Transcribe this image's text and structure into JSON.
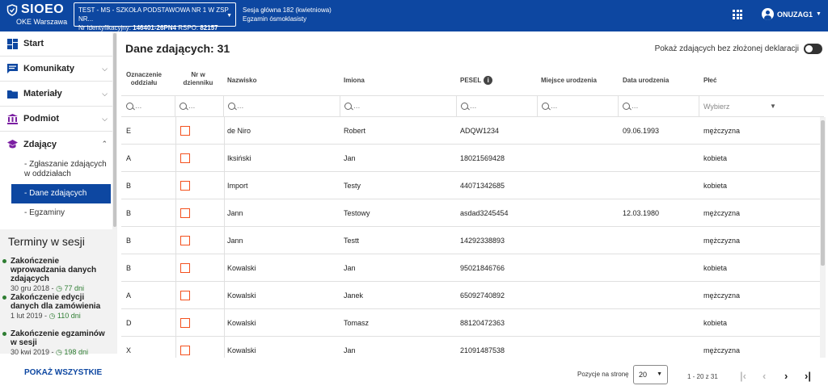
{
  "header": {
    "app_name": "SIOEO",
    "org": "OKE Warszawa",
    "school_line1": "TEST - MS - SZKOŁA PODSTAWOWA NR 1 W ZSP NR...",
    "school_id_label": "Nr identyfikacyjny:",
    "school_id_value": "146401-26PN4",
    "rspo_label": "RSPO:",
    "rspo_value": "82157",
    "session_line1": "Sesja główna 182 (kwietniowa)",
    "session_line2": "Egzamin ósmoklasisty",
    "user_name": "ONUZAG1",
    "icons": [
      "apps-icon",
      "account-icon",
      "caret-down-icon"
    ]
  },
  "sidebar": {
    "items": [
      {
        "label": "Start",
        "icon": "dashboard-icon"
      },
      {
        "label": "Komunikaty",
        "icon": "message-icon"
      },
      {
        "label": "Materiały",
        "icon": "folder-icon"
      },
      {
        "label": "Podmiot",
        "icon": "bank-icon"
      },
      {
        "label": "Zdający",
        "icon": "graduation-cap-icon"
      }
    ],
    "subitems": [
      {
        "label": "- Zgłaszanie zdających w oddziałach"
      },
      {
        "label": "- Dane zdających"
      },
      {
        "label": "- Egzaminy"
      }
    ],
    "terms_title": "Terminy w sesji",
    "terms": [
      {
        "title": "Zakończenie wprowadzania danych zdających",
        "date": "30 gru 2018 -",
        "days": "77 dni"
      },
      {
        "title": "Zakończenie edycji danych dla zamówienia",
        "date": "1 lut 2019 -",
        "days": "110 dni"
      },
      {
        "title": "Zakończenie egzaminów w sesji",
        "date": "30 kwi 2019 -",
        "days": "198 dni"
      }
    ],
    "show_all": "POKAŻ WSZYSTKIE"
  },
  "main": {
    "title": "Dane zdających: 31",
    "toggle_label": "Pokaż zdających bez złożonej deklaracji",
    "toggle_on": false,
    "columns": [
      "Oznaczenie oddziału",
      "Nr w dzienniku",
      "Nazwisko",
      "Imiona",
      "PESEL",
      "Miejsce urodzenia",
      "Data urodzenia",
      "Płeć"
    ],
    "filter_placeholder": "...",
    "gender_filter_placeholder": "Wybierz",
    "rows": [
      {
        "class": "E",
        "surname": "de Niro",
        "names": "Robert",
        "pesel": "ADQW1234",
        "birthplace": "",
        "birthdate": "09.06.1993",
        "gender": "mężczyzna"
      },
      {
        "class": "A",
        "surname": "Iksiński",
        "names": "Jan",
        "pesel": "18021569428",
        "birthplace": "",
        "birthdate": "",
        "gender": "kobieta"
      },
      {
        "class": "B",
        "surname": "Import",
        "names": "Testy",
        "pesel": "44071342685",
        "birthplace": "",
        "birthdate": "",
        "gender": "kobieta"
      },
      {
        "class": "B",
        "surname": "Jann",
        "names": "Testowy",
        "pesel": "asdad3245454",
        "birthplace": "",
        "birthdate": "12.03.1980",
        "gender": "mężczyzna"
      },
      {
        "class": "B",
        "surname": "Jann",
        "names": "Testt",
        "pesel": "14292338893",
        "birthplace": "",
        "birthdate": "",
        "gender": "mężczyzna"
      },
      {
        "class": "B",
        "surname": "Kowalski",
        "names": "Jan",
        "pesel": "95021846766",
        "birthplace": "",
        "birthdate": "",
        "gender": "kobieta"
      },
      {
        "class": "A",
        "surname": "Kowalski",
        "names": "Janek",
        "pesel": "65092740892",
        "birthplace": "",
        "birthdate": "",
        "gender": "mężczyzna"
      },
      {
        "class": "D",
        "surname": "Kowalski",
        "names": "Tomasz",
        "pesel": "88120472363",
        "birthplace": "",
        "birthdate": "",
        "gender": "kobieta"
      },
      {
        "class": "X",
        "surname": "Kowalski",
        "names": "Jan",
        "pesel": "21091487538",
        "birthplace": "",
        "birthdate": "",
        "gender": "mężczyzna"
      }
    ],
    "checkbox_color": "#f4511e"
  },
  "pager": {
    "per_page_label": "Pozycje na stronę",
    "per_page_value": "20",
    "range": "1 - 20 z 31"
  },
  "colors": {
    "primary": "#0d47a1",
    "success": "#2e7d32"
  }
}
